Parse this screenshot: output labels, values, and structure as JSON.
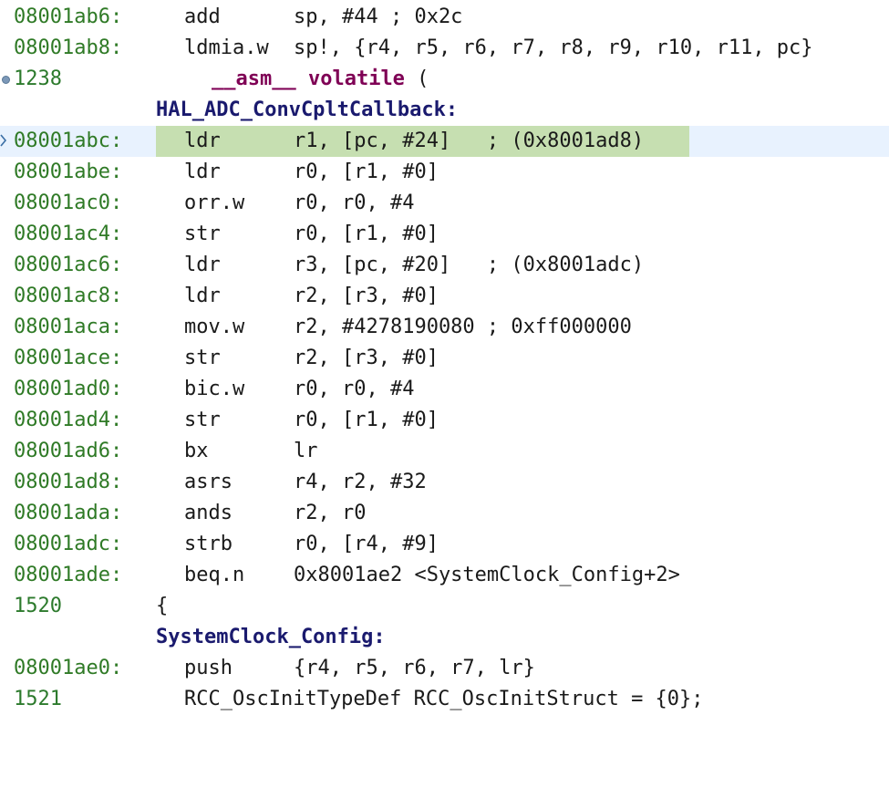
{
  "lines": [
    {
      "addr": "08001ab6:",
      "mnem": "add",
      "ops": "sp, #44 ; 0x2c"
    },
    {
      "addr": "08001ab8:",
      "mnem": "ldmia.w",
      "ops": "sp!, {r4, r5, r6, r7, r8, r9, r10, r11, pc}"
    },
    {
      "lnum": "1238",
      "asm_kw": "__asm__",
      "volatile_kw": "volatile",
      "rest": " ("
    },
    {
      "label": "HAL_ADC_ConvCpltCallback:"
    },
    {
      "addr": "08001abc:",
      "mnem": "ldr",
      "ops": "r1, [pc, #24]   ; (0x8001ad8)"
    },
    {
      "addr": "08001abe:",
      "mnem": "ldr",
      "ops": "r0, [r1, #0]"
    },
    {
      "addr": "08001ac0:",
      "mnem": "orr.w",
      "ops": "r0, r0, #4"
    },
    {
      "addr": "08001ac4:",
      "mnem": "str",
      "ops": "r0, [r1, #0]"
    },
    {
      "addr": "08001ac6:",
      "mnem": "ldr",
      "ops": "r3, [pc, #20]   ; (0x8001adc)"
    },
    {
      "addr": "08001ac8:",
      "mnem": "ldr",
      "ops": "r2, [r3, #0]"
    },
    {
      "addr": "08001aca:",
      "mnem": "mov.w",
      "ops": "r2, #4278190080 ; 0xff000000"
    },
    {
      "addr": "08001ace:",
      "mnem": "str",
      "ops": "r2, [r3, #0]"
    },
    {
      "addr": "08001ad0:",
      "mnem": "bic.w",
      "ops": "r0, r0, #4"
    },
    {
      "addr": "08001ad4:",
      "mnem": "str",
      "ops": "r0, [r1, #0]"
    },
    {
      "addr": "08001ad6:",
      "mnem": "bx",
      "ops": "lr"
    },
    {
      "addr": "08001ad8:",
      "mnem": "asrs",
      "ops": "r4, r2, #32"
    },
    {
      "addr": "08001ada:",
      "mnem": "ands",
      "ops": "r2, r0"
    },
    {
      "addr": "08001adc:",
      "mnem": "strb",
      "ops": "r0, [r4, #9]"
    },
    {
      "addr": "08001ade:",
      "mnem": "beq.n",
      "ops": "0x8001ae2 <SystemClock_Config+2>"
    },
    {
      "lnum": "1520",
      "src": "{"
    },
    {
      "label": "SystemClock_Config:"
    },
    {
      "addr": "08001ae0:",
      "mnem": "push",
      "ops": "{r4, r5, r6, r7, lr}"
    },
    {
      "lnum": "1521",
      "src": "RCC_OscInitTypeDef RCC_OscInitStruct = {0};"
    }
  ],
  "colors": {
    "address": "#2c7a2c",
    "label": "#1a1a6e",
    "keyword": "#7f0055",
    "current_line_bg": "#e8f2fe",
    "highlight_bg": "#c6dfb1"
  },
  "icons": {
    "breakpoint": "breakpoint-icon",
    "current_instruction": "current-instruction-arrow-icon"
  }
}
